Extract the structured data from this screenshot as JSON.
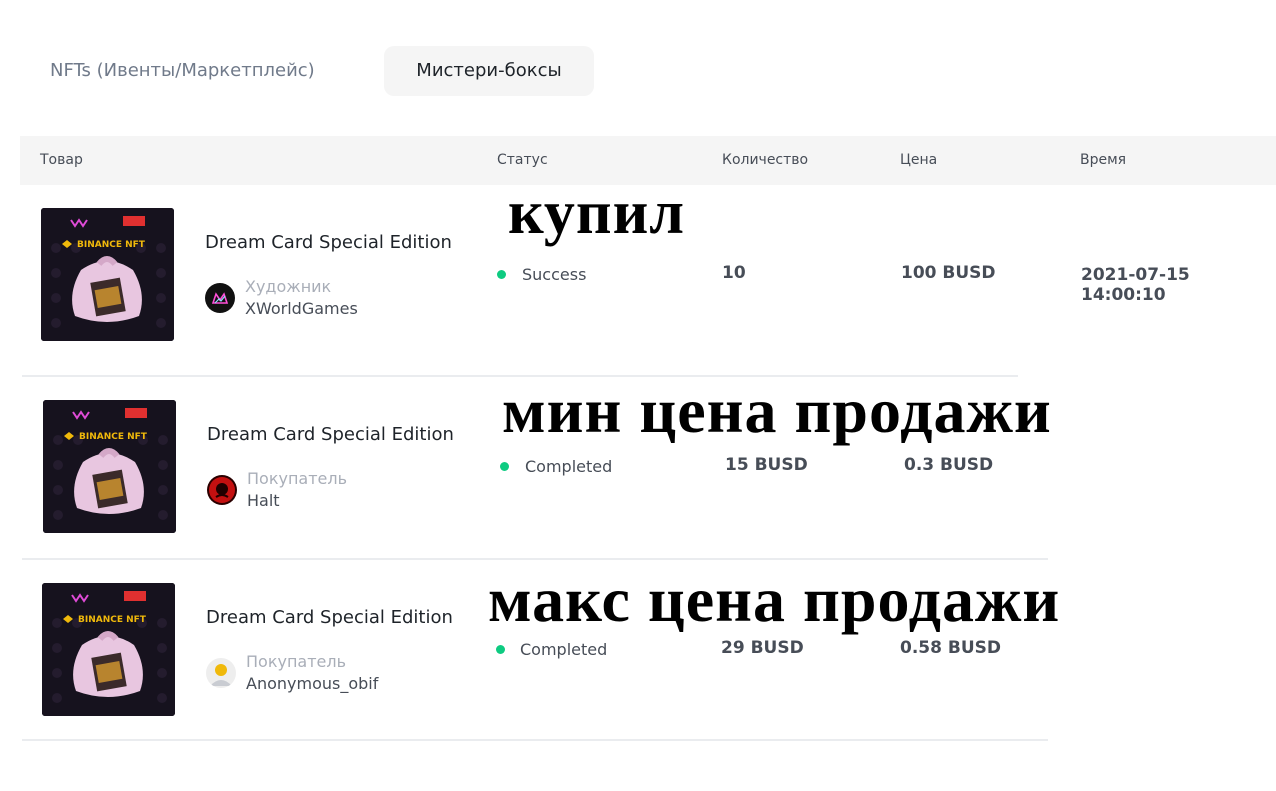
{
  "tabs": [
    {
      "label": "NFTs (Ивенты/Маркетплейс)",
      "active": false
    },
    {
      "label": "Мистери-боксы",
      "active": true
    }
  ],
  "table": {
    "headers": {
      "item": "Товар",
      "status": "Статус",
      "quantity": "Количество",
      "price": "Цена",
      "time": "Время"
    },
    "rows": [
      {
        "title": "Dream Card Special Edition",
        "role": "Художник",
        "user": "XWorldGames",
        "status": "Success",
        "quantity": "10",
        "price": "100 BUSD",
        "time": "2021-07-15 14:00:10",
        "thumb_text": "BINANCE NFT"
      },
      {
        "title": "Dream Card Special Edition",
        "role": "Покупатель",
        "user": "Halt",
        "status": "Completed",
        "quantity": "15 BUSD",
        "price": "0.3 BUSD",
        "time": "",
        "thumb_text": "BINANCE NFT"
      },
      {
        "title": "Dream Card Special Edition",
        "role": "Покупатель",
        "user": "Anonymous_obif",
        "status": "Completed",
        "quantity": "29 BUSD",
        "price": "0.58 BUSD",
        "time": "",
        "thumb_text": "BINANCE NFT"
      }
    ]
  },
  "annotations": {
    "bought": "купил",
    "min_price": "мин цена продажи",
    "max_price": "макс цена продажи"
  },
  "colors": {
    "status_dot": "#0ecb81",
    "header_bg": "#f5f5f5",
    "binance_yellow": "#f0b90b"
  }
}
